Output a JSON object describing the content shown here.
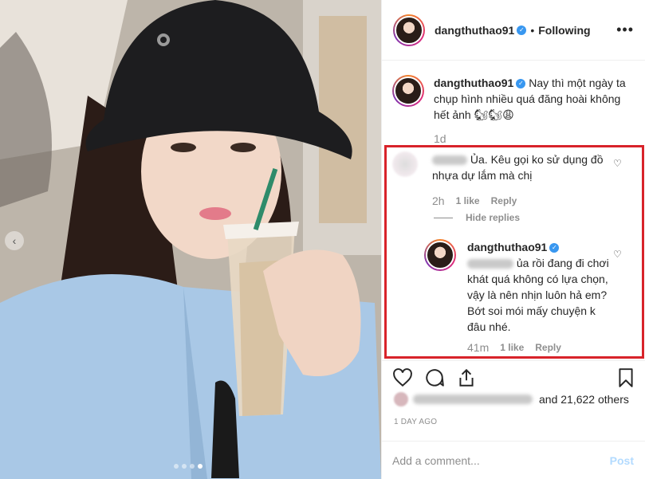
{
  "post": {
    "username": "dangthuthao91",
    "follow_status": "Following",
    "more_icon": "more-horizontal-icon",
    "caption": "Nay thì một ngày ta chụp hình nhiều quá đăng hoài không hết ảnh 🐿🐿😩",
    "caption_time": "1d"
  },
  "comments": [
    {
      "text": "Ủa. Kêu gọi ko sử dụng đồ nhựa dự lắm mà chị",
      "time": "2h",
      "likes": "1 like",
      "reply_label": "Reply"
    }
  ],
  "hide_replies_label": "Hide replies",
  "reply": {
    "username": "dangthuthao91",
    "text": "ủa rồi đang đi chơi khát quá không có lựa chọn, vậy là nên nhịn luôn hả em? Bớt soi mói mấy chuyện k đâu nhé.",
    "time": "41m",
    "likes": "1 like",
    "reply_label": "Reply"
  },
  "likes_summary": "and 21,622 others",
  "post_date": "1 DAY AGO",
  "comment_input": {
    "placeholder": "Add a comment...",
    "post_label": "Post"
  },
  "colors": {
    "link_blue": "#3897f0",
    "highlight_red": "#d8232a",
    "muted": "#8e8e8e"
  }
}
